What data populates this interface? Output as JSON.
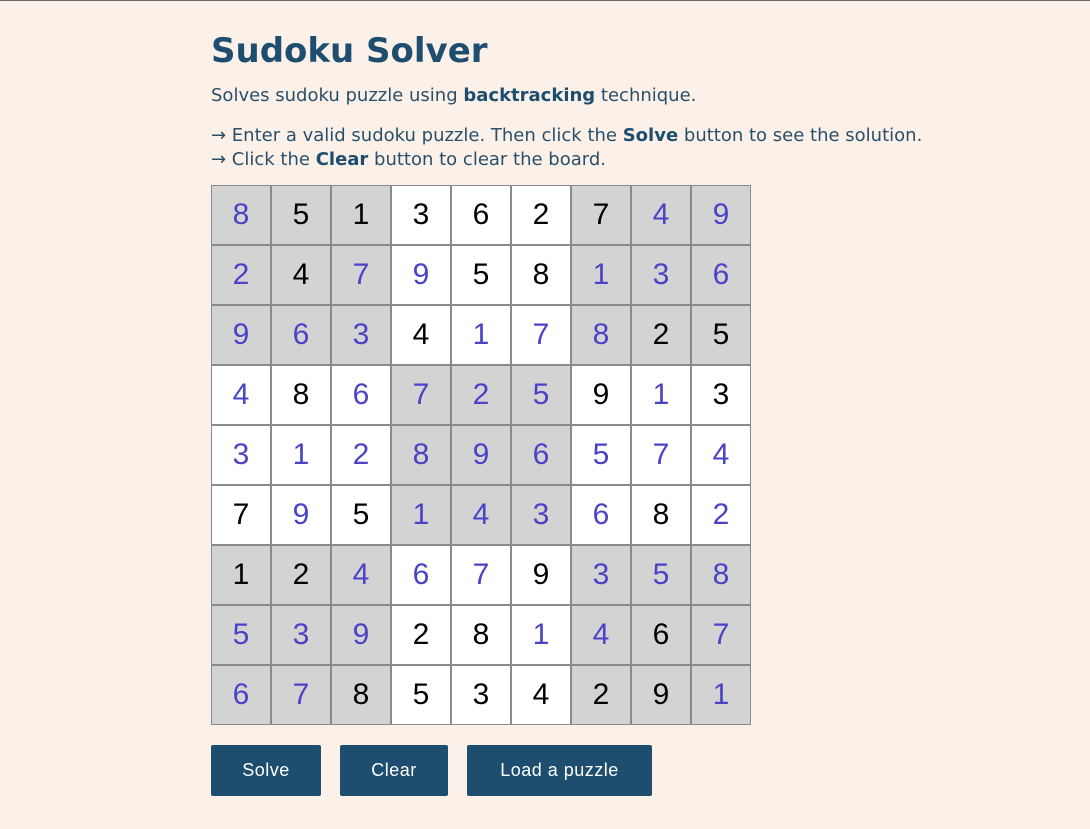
{
  "title": "Sudoku Solver",
  "subtitle": {
    "prefix": "Solves sudoku puzzle using ",
    "bold": "backtracking",
    "suffix": " technique."
  },
  "instructions": [
    {
      "prefix": "→ Enter a valid sudoku puzzle. Then click the ",
      "bold": "Solve",
      "suffix": " button to see the solution."
    },
    {
      "prefix": "→ Click the ",
      "bold": "Clear",
      "suffix": " button to clear the board."
    }
  ],
  "board": {
    "values": [
      [
        8,
        5,
        1,
        3,
        6,
        2,
        7,
        4,
        9
      ],
      [
        2,
        4,
        7,
        9,
        5,
        8,
        1,
        3,
        6
      ],
      [
        9,
        6,
        3,
        4,
        1,
        7,
        8,
        2,
        5
      ],
      [
        4,
        8,
        6,
        7,
        2,
        5,
        9,
        1,
        3
      ],
      [
        3,
        1,
        2,
        8,
        9,
        6,
        5,
        7,
        4
      ],
      [
        7,
        9,
        5,
        1,
        4,
        3,
        6,
        8,
        2
      ],
      [
        1,
        2,
        4,
        6,
        7,
        9,
        3,
        5,
        8
      ],
      [
        5,
        3,
        9,
        2,
        8,
        1,
        4,
        6,
        7
      ],
      [
        6,
        7,
        8,
        5,
        3,
        4,
        2,
        9,
        1
      ]
    ],
    "given": [
      [
        0,
        1,
        1,
        1,
        1,
        1,
        1,
        0,
        0
      ],
      [
        0,
        1,
        0,
        0,
        1,
        1,
        0,
        0,
        0
      ],
      [
        0,
        0,
        0,
        1,
        0,
        0,
        0,
        1,
        1
      ],
      [
        0,
        1,
        0,
        0,
        0,
        0,
        1,
        0,
        1
      ],
      [
        0,
        0,
        0,
        0,
        0,
        0,
        0,
        0,
        0
      ],
      [
        1,
        0,
        1,
        0,
        0,
        0,
        0,
        1,
        0
      ],
      [
        1,
        1,
        0,
        0,
        0,
        1,
        0,
        0,
        0
      ],
      [
        0,
        0,
        0,
        1,
        1,
        0,
        0,
        1,
        0
      ],
      [
        0,
        0,
        1,
        1,
        1,
        1,
        1,
        1,
        0
      ]
    ],
    "given_color": "#000000",
    "solved_color": "#4a43c7",
    "shaded_color": "#d3d3d3",
    "unshaded_color": "#ffffff"
  },
  "buttons": {
    "solve": "Solve",
    "clear": "Clear",
    "load": "Load a puzzle"
  },
  "colors": {
    "background": "#fcf1e9",
    "primary": "#1d4e6f"
  }
}
